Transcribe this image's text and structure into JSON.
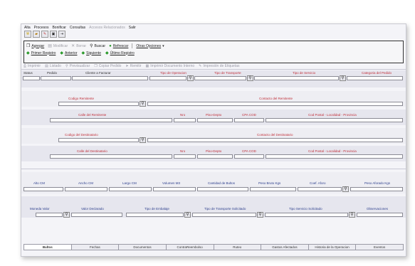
{
  "menu": [
    "Alta",
    "Procesos",
    "Bonificar",
    "Consultas",
    "Accesos Relacionados",
    "Salir"
  ],
  "menu_disabled": [
    false,
    false,
    false,
    false,
    true,
    false
  ],
  "toolbar": {
    "agregar": "Agregar",
    "modificar": "Modificar",
    "borrar": "Borrar",
    "buscar": "Buscar",
    "refrescar": "Refrescar",
    "otras": "Otras Opciones",
    "primero": "Primer Registro",
    "anterior": "Anterior",
    "siguiente": "Siguiente",
    "ultimo": "Último Registro"
  },
  "actions": [
    "Imprimir",
    "Listado",
    "Previsualizar",
    "Copiar Pedido",
    "Remitir",
    "Imprimir Documento Interno",
    "Impresión de Etiquetas"
  ],
  "labels": {
    "status": "Status",
    "pedido": "Pedido",
    "cliente": "Cliente a Facturar",
    "tipo_operacion": "Tipo de Operacion",
    "tipo_transporte": "Tipo de Transporte",
    "tipo_servicio": "Tipo de Servicio",
    "categoria": "Categoria del Pedido",
    "codigo_remitente": "Codigo Remitente",
    "contacto_remitente": "Contacto del Remitente",
    "calle_remitente": "Calle del Remitente",
    "nro": "Nro",
    "piso_depto": "Piso-Depto",
    "cpa_cod": "CPA COD",
    "cod_postal": "Cod Postal - Localidad - Provincia",
    "codigo_destinatario": "Codigo del Destinatario",
    "contacto_destinatario": "Contacto del Destinatario",
    "calle_destinatario": "Calle del Destinatario",
    "alto": "Alto CM",
    "ancho": "Ancho CM",
    "largo": "Largo CM",
    "volumen": "Volumen M3",
    "cantidad_bultos": "Cantidad de Bultos",
    "peso_bruto": "Peso Bruto Kgs",
    "coef_aforo": "Coef. Aforo",
    "peso_aforado": "Peso Aforado Kgs",
    "moneda": "Moneda Valor",
    "valor_declarado": "Valor Declarado",
    "tipo_embalaje": "Tipo de Embalaje",
    "tipo_transporte_sol": "Tipo de Transporte Solicitado",
    "tipo_servicio_sol": "Tipo Servicio Solicitado",
    "observaciones": "Observaciones"
  },
  "tabs": [
    "Bultos",
    "Fechas",
    "Documentos",
    "ContraReembolso",
    "Ruteo",
    "Gastos Afectados",
    "Historia de la Operacion",
    "Eventos"
  ]
}
